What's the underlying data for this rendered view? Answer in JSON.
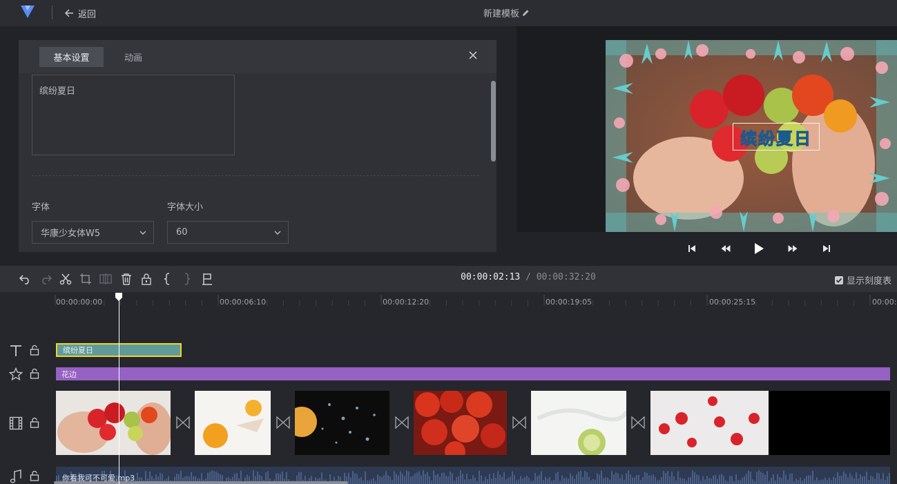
{
  "topbar": {
    "back_label": "返回",
    "title": "新建模板"
  },
  "panel": {
    "tabs": [
      {
        "label": "基本设置",
        "active": true
      },
      {
        "label": "动画",
        "active": false
      }
    ],
    "text_value": "缤纷夏日",
    "font_label": "字体",
    "font_value": "华康少女体W5",
    "size_label": "字体大小",
    "size_value": "60"
  },
  "preview": {
    "overlay_text": "缤纷夏日"
  },
  "toolbar": {
    "time_current": "00:00:02:13",
    "time_separator": "/",
    "time_total": "00:00:32:20",
    "scale_toggle_label": "显示刻度表",
    "scale_toggle_checked": true
  },
  "timeline": {
    "ruler_labels": [
      "00:00:00:00",
      "00:00:06:10",
      "00:00:12:20",
      "00:00:19:05",
      "00:00:25:15",
      "00:00:3"
    ],
    "text_clip_label": "缤纷夏日",
    "border_clip_label": "花边",
    "audio_clip_label": "你看我可不可爱.mp3"
  },
  "colors": {
    "accent_yellow": "#f2d32a",
    "text_clip": "#5f9b9b",
    "border_clip": "#9561c2",
    "audio_clip": "#2e3a52"
  }
}
